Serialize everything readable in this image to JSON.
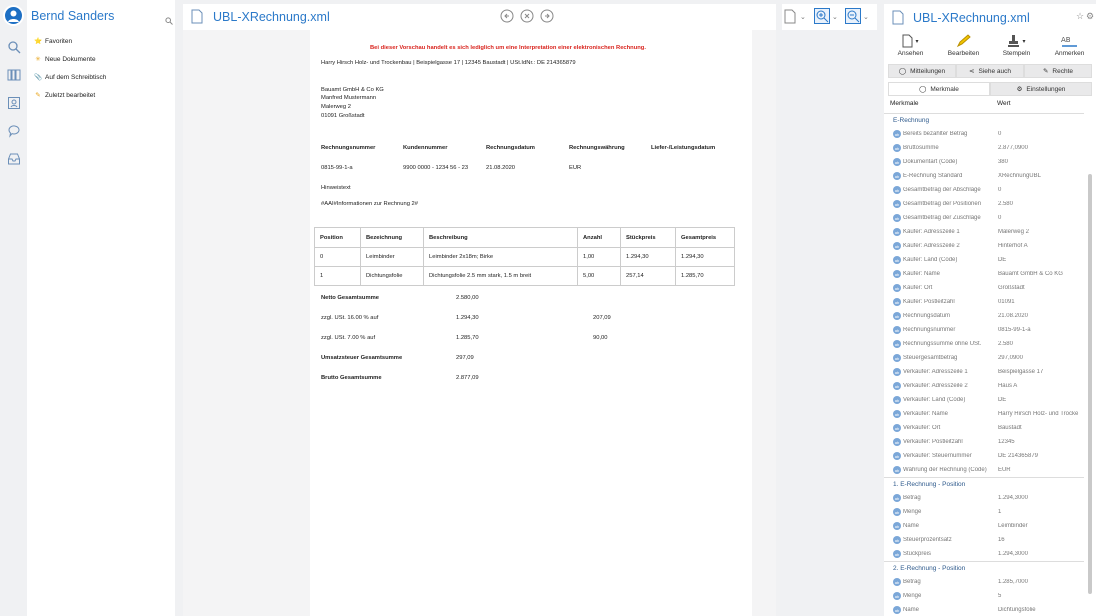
{
  "user": {
    "name": "Bernd Sanders"
  },
  "nav": [
    "Favoriten",
    "Neue Dokumente",
    "Auf dem Schreibtisch",
    "Zuletzt bearbeitet"
  ],
  "viewer": {
    "title": "UBL-XRechnung.xml"
  },
  "doc": {
    "warning": "Bei dieser Vorschau handelt es sich lediglich um eine Interpretation einer elektronischen Rechnung.",
    "sender": "Harry Hirsch Holz- und Trockenbau | Beispielgasse 17 | 12345 Baustadt | USt.IdNr.: DE 214365879",
    "recipient": [
      "Bauamt GmbH & Co KG",
      "Manfred Mustermann",
      "Malerweg 2",
      "01091 Großstadt"
    ],
    "meta_headers": [
      "Rechnungsnummer",
      "Kundennummer",
      "Rechnungsdatum",
      "Rechnungswährung",
      "Liefer-/Leistungsdatum"
    ],
    "meta_values": [
      "0815-99-1-a",
      "9900 0000 - 1234 56 - 23",
      "21.08.2020",
      "EUR",
      ""
    ],
    "hint_label": "Hinweistext",
    "hint": "#AAI#Informationen zur Rechnung 2#",
    "items_header": [
      "Position",
      "Bezeichnung",
      "Beschreibung",
      "Anzahl",
      "Stückpreis",
      "Gesamtpreis"
    ],
    "items": [
      [
        "0",
        "Leimbinder",
        "Leimbinder 2x18m; Birke",
        "1,00",
        "1.294,30",
        "1.294,30"
      ],
      [
        "1",
        "Dichtungsfolie",
        "Dichtungsfolie 2.5 mm stark, 1.5 m breit",
        "5,00",
        "257,14",
        "1.285,70"
      ]
    ],
    "netto_label": "Netto Gesamtsumme",
    "netto": "2.580,00",
    "ust16_label": "zzgl. USt. 16.00 % auf",
    "ust16_base": "1.294,30",
    "ust16_val": "207,09",
    "ust7_label": "zzgl. USt. 7.00 % auf",
    "ust7_base": "1.285,70",
    "ust7_val": "90,00",
    "ust_total_label": "Umsatzsteuer Gesamtsumme",
    "ust_total": "297,09",
    "brutto_label": "Brutto Gesamtsumme",
    "brutto": "2.877,09"
  },
  "right": {
    "title": "UBL-XRechnung.xml",
    "actions": [
      "Ansehen",
      "Bearbeiten",
      "Stempeln",
      "Anmerken"
    ],
    "tabs1": [
      "Mitteilungen",
      "Siehe auch",
      "Rechte"
    ],
    "tabs2": [
      "Merkmale",
      "Einstellungen"
    ],
    "col_key": "Merkmale",
    "col_val": "Wert"
  },
  "props": {
    "sec1": "E-Rechnung",
    "rows1": [
      [
        "Bereits bezahlter Betrag",
        "0"
      ],
      [
        "Bruttosumme",
        "2.877,0900"
      ],
      [
        "Dokumentart (Code)",
        "380"
      ],
      [
        "E-Rechnung Standard",
        "XRechnungUBL"
      ],
      [
        "Gesamtbetrag der Abschläge",
        "0"
      ],
      [
        "Gesamtbetrag der Positionen",
        "2.580"
      ],
      [
        "Gesamtbetrag der Zuschläge",
        "0"
      ],
      [
        "Käufer: Adresszeile 1",
        "Malerweg 2"
      ],
      [
        "Käufer: Adresszeile 2",
        "Hinterhof A"
      ],
      [
        "Käufer: Land (Code)",
        "DE"
      ],
      [
        "Käufer: Name",
        "Bauamt GmbH & Co KG"
      ],
      [
        "Käufer: Ort",
        "Großstadt"
      ],
      [
        "Käufer: Postleitzahl",
        "01091"
      ],
      [
        "Rechnungsdatum",
        "21.08.2020"
      ],
      [
        "Rechnungsnummer",
        "0815-99-1-a"
      ],
      [
        "Rechnungssumme ohne USt.",
        "2.580"
      ],
      [
        "Steuergesamtbetrag",
        "297,0900"
      ],
      [
        "Verkäufer: Adresszeile 1",
        "Beispielgasse 17"
      ],
      [
        "Verkäufer: Adresszeile 2",
        "Haus A"
      ],
      [
        "Verkäufer: Land (Code)",
        "DE"
      ],
      [
        "Verkäufer: Name",
        "Harry Hirsch Holz- und Trocke"
      ],
      [
        "Verkäufer: Ort",
        "Baustadt"
      ],
      [
        "Verkäufer: Postleitzahl",
        "12345"
      ],
      [
        "Verkäufer: Steuernummer",
        "DE 214365879"
      ],
      [
        "Währung der Rechnung (Code)",
        "EUR"
      ]
    ],
    "sec2": "1. E-Rechnung - Position",
    "rows2": [
      [
        "Betrag",
        "1.294,3000"
      ],
      [
        "Menge",
        "1"
      ],
      [
        "Name",
        "Leimbinder"
      ],
      [
        "Steuerprozentsatz",
        "16"
      ],
      [
        "Stückpreis",
        "1.294,3000"
      ]
    ],
    "sec3": "2. E-Rechnung - Position",
    "rows3": [
      [
        "Betrag",
        "1.285,7000"
      ],
      [
        "Menge",
        "5"
      ],
      [
        "Name",
        "Dichtungsfolie"
      ]
    ]
  }
}
